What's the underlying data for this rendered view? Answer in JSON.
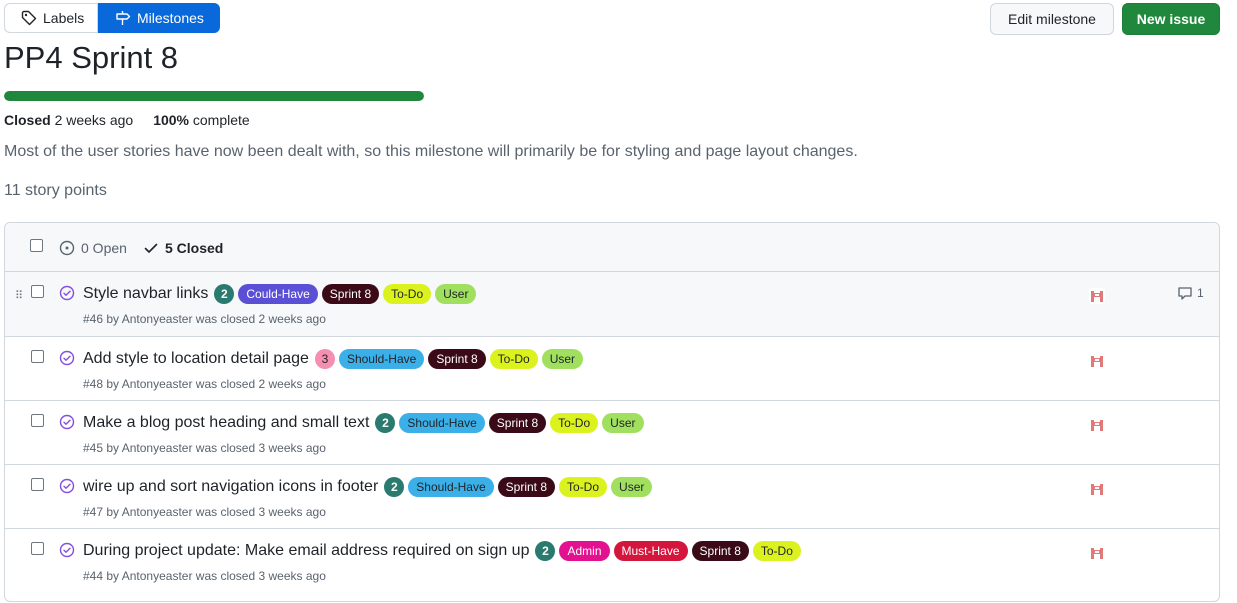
{
  "nav": {
    "labels_label": "Labels",
    "milestones_label": "Milestones"
  },
  "actions": {
    "edit_label": "Edit milestone",
    "new_issue_label": "New issue"
  },
  "milestone": {
    "title": "PP4 Sprint 8",
    "progress_fraction": 1.0,
    "closed_label": "Closed",
    "closed_when": "2 weeks ago",
    "percent": "100%",
    "complete_label": "complete",
    "description": "Most of the user stories have now been dealt with, so this milestone will primarily be for styling and page layout changes.",
    "story_points": "11 story points"
  },
  "list_header": {
    "open": "0 Open",
    "closed": "5 Closed"
  },
  "colors": {
    "green": "#1f883d",
    "blue": "#0969da",
    "closed_purple": "#8250df"
  },
  "issues": [
    {
      "title": "Style navbar links",
      "points": "2",
      "points_style": "teal",
      "labels": [
        {
          "text": "Could-Have",
          "bg": "#5b4fd6",
          "fg": "#ffffff"
        },
        {
          "text": "Sprint 8",
          "bg": "#3b0a17",
          "fg": "#ffffff"
        },
        {
          "text": "To-Do",
          "bg": "#dcf21f",
          "fg": "#1f2328"
        },
        {
          "text": "User",
          "bg": "#a0e05e",
          "fg": "#1f2328"
        }
      ],
      "number": "#46",
      "by": "by",
      "author": "Antonyeaster",
      "closed_text": "was closed 2 weeks ago",
      "comments": "1"
    },
    {
      "title": "Add style to location detail page",
      "points": "3",
      "points_style": "pink",
      "labels": [
        {
          "text": "Should-Have",
          "bg": "#3bb0e8",
          "fg": "#1f2328"
        },
        {
          "text": "Sprint 8",
          "bg": "#3b0a17",
          "fg": "#ffffff"
        },
        {
          "text": "To-Do",
          "bg": "#dcf21f",
          "fg": "#1f2328"
        },
        {
          "text": "User",
          "bg": "#a0e05e",
          "fg": "#1f2328"
        }
      ],
      "number": "#48",
      "by": "by",
      "author": "Antonyeaster",
      "closed_text": "was closed 2 weeks ago",
      "comments": ""
    },
    {
      "title": "Make a blog post heading and small text",
      "points": "2",
      "points_style": "teal",
      "labels": [
        {
          "text": "Should-Have",
          "bg": "#3bb0e8",
          "fg": "#1f2328"
        },
        {
          "text": "Sprint 8",
          "bg": "#3b0a17",
          "fg": "#ffffff"
        },
        {
          "text": "To-Do",
          "bg": "#dcf21f",
          "fg": "#1f2328"
        },
        {
          "text": "User",
          "bg": "#a0e05e",
          "fg": "#1f2328"
        }
      ],
      "number": "#45",
      "by": "by",
      "author": "Antonyeaster",
      "closed_text": "was closed 3 weeks ago",
      "comments": ""
    },
    {
      "title": "wire up and sort navigation icons in footer",
      "points": "2",
      "points_style": "teal",
      "labels": [
        {
          "text": "Should-Have",
          "bg": "#3bb0e8",
          "fg": "#1f2328"
        },
        {
          "text": "Sprint 8",
          "bg": "#3b0a17",
          "fg": "#ffffff"
        },
        {
          "text": "To-Do",
          "bg": "#dcf21f",
          "fg": "#1f2328"
        },
        {
          "text": "User",
          "bg": "#a0e05e",
          "fg": "#1f2328"
        }
      ],
      "number": "#47",
      "by": "by",
      "author": "Antonyeaster",
      "closed_text": "was closed 3 weeks ago",
      "comments": ""
    },
    {
      "title": "During project update: Make email address required on sign up",
      "points": "2",
      "points_style": "teal",
      "labels": [
        {
          "text": "Admin",
          "bg": "#e3118f",
          "fg": "#ffffff"
        },
        {
          "text": "Must-Have",
          "bg": "#d4163c",
          "fg": "#ffffff"
        },
        {
          "text": "Sprint 8",
          "bg": "#3b0a17",
          "fg": "#ffffff"
        },
        {
          "text": "To-Do",
          "bg": "#dcf21f",
          "fg": "#1f2328"
        }
      ],
      "number": "#44",
      "by": "by",
      "author": "Antonyeaster",
      "closed_text": "was closed 3 weeks ago",
      "comments": ""
    }
  ]
}
